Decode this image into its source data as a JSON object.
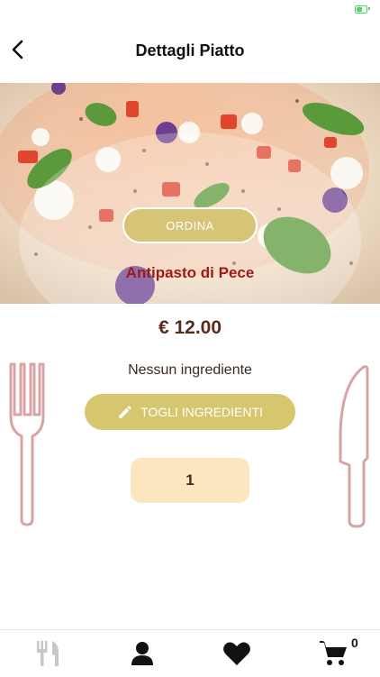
{
  "header": {
    "title": "Dettagli Piatto"
  },
  "dish": {
    "order_label": "ORDINA",
    "name": "Antipasto di Pece",
    "price": "€ 12.00",
    "ingredients_text": "Nessun ingrediente",
    "remove_ingredients_label": "TOGLI INGREDIENTI",
    "quantity": "1"
  },
  "tabbar": {
    "items": [
      {
        "icon": "utensils-icon"
      },
      {
        "icon": "user-icon"
      },
      {
        "icon": "heart-icon"
      },
      {
        "icon": "cart-icon"
      }
    ],
    "cart_count": "0"
  },
  "colors": {
    "accent_gold": "#d6c477",
    "dish_name": "#9c1a1a",
    "price": "#5a2a1c",
    "quantity_bg": "#fbe6c0",
    "cutlery": "#d9a3a3"
  }
}
